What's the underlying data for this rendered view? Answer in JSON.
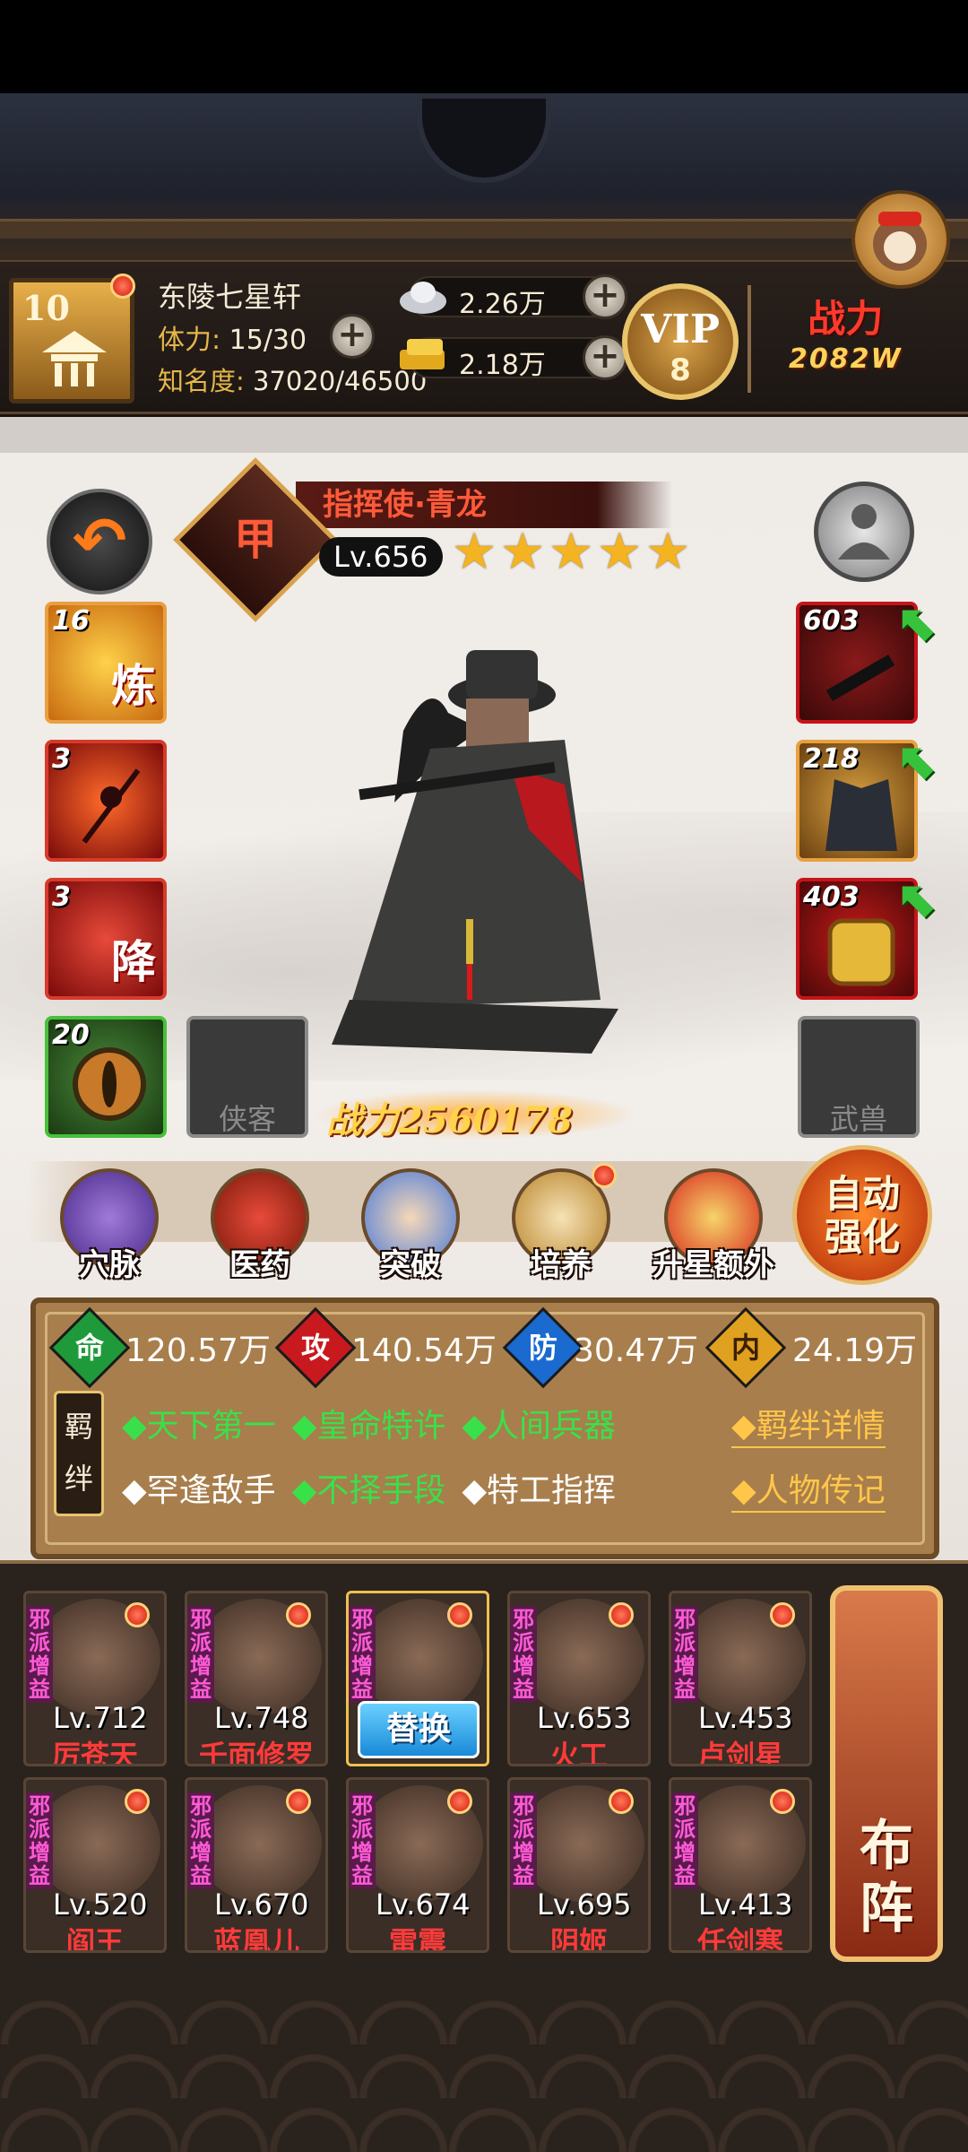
{
  "topbar": {
    "player_level": "10",
    "guild_name": "东陵七星轩",
    "stamina_label": "体力:",
    "stamina_value": " 15/30",
    "fame_label": "知名度:",
    "fame_value": " 37020/46500",
    "silver": "2.26万",
    "gold": "2.18万",
    "vip_label": "VIP",
    "vip_level": "8",
    "power_label": "战力",
    "power_value": "2082W"
  },
  "hero": {
    "title": "指挥使·青龙",
    "rank_char": "甲",
    "level": "Lv.656",
    "stars": 5,
    "combat_power_label": "战力",
    "combat_power": "2560178"
  },
  "skills": [
    {
      "count": "16",
      "char": "炼"
    },
    {
      "count": "3",
      "char": ""
    },
    {
      "count": "3",
      "char": "降"
    },
    {
      "count": "20",
      "char": ""
    }
  ],
  "equipment": [
    {
      "count": "603"
    },
    {
      "count": "218"
    },
    {
      "count": "403"
    }
  ],
  "slots": {
    "companion": "侠客",
    "beast": "武兽"
  },
  "functions": [
    {
      "label": "穴脉"
    },
    {
      "label": "医药"
    },
    {
      "label": "突破"
    },
    {
      "label": "培养"
    },
    {
      "label": "升星额外"
    }
  ],
  "auto_button": {
    "line1": "自动",
    "line2": "强化"
  },
  "stats": [
    {
      "icon": "命",
      "value": "120.57万",
      "color": "#1f9a3a"
    },
    {
      "icon": "攻",
      "value": "140.54万",
      "color": "#c8191e"
    },
    {
      "icon": "防",
      "value": "30.47万",
      "color": "#1a6ad0"
    },
    {
      "icon": "内",
      "value": "24.19万",
      "color": "#e0a020"
    }
  ],
  "bonds": {
    "tag": "羁绊",
    "row1": [
      {
        "text": "◆天下第一",
        "active": true
      },
      {
        "text": "◆皇命特许",
        "active": true
      },
      {
        "text": "◆人间兵器",
        "active": true
      }
    ],
    "row2": [
      {
        "text": "◆罕逢敌手",
        "active": false
      },
      {
        "text": "◆不择手段",
        "active": true
      },
      {
        "text": "◆特工指挥",
        "active": false
      }
    ],
    "link_details": "◆羁绊详情",
    "link_biography": "◆人物传记"
  },
  "roster": {
    "tag": "邪派增益",
    "replace_label": "替换",
    "formation_label": "布阵",
    "heroes": [
      {
        "level": "Lv.712",
        "name": "厉苍天"
      },
      {
        "level": "Lv.748",
        "name": "千面修罗"
      },
      {
        "level": "",
        "name": ""
      },
      {
        "level": "Lv.653",
        "name": "火工"
      },
      {
        "level": "Lv.453",
        "name": "卢剑星"
      },
      {
        "level": "Lv.520",
        "name": "阎王"
      },
      {
        "level": "Lv.670",
        "name": "蓝凰儿"
      },
      {
        "level": "Lv.674",
        "name": "雷震"
      },
      {
        "level": "Lv.695",
        "name": "阴姬"
      },
      {
        "level": "Lv.413",
        "name": "任剑寒"
      }
    ]
  }
}
